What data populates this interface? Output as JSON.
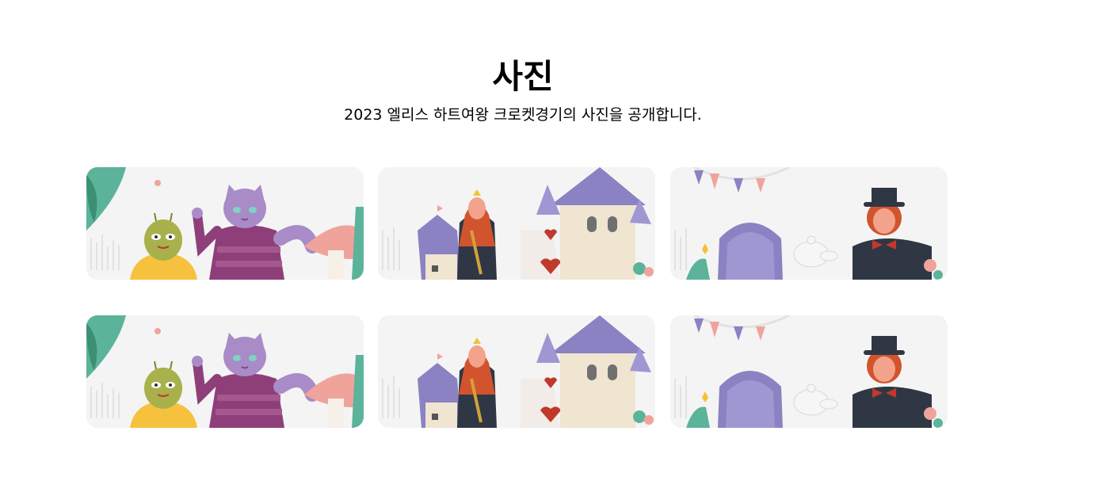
{
  "page": {
    "title": "사진",
    "subtitle": "2023 엘리스 하트여왕 크로켓경기의 사진을 공개합니다."
  },
  "gallery": {
    "rows": [
      [
        "caterpillar-cheshire-cat",
        "queen-of-hearts-castle",
        "mad-hatter-tea-party"
      ],
      [
        "caterpillar-cheshire-cat",
        "queen-of-hearts-castle",
        "mad-hatter-tea-party"
      ]
    ]
  },
  "colors": {
    "card_bg": "#f4f4f4",
    "purple": "#8a82c2",
    "green": "#5bb39a",
    "pink": "#f0a39b",
    "red": "#c0392b"
  }
}
